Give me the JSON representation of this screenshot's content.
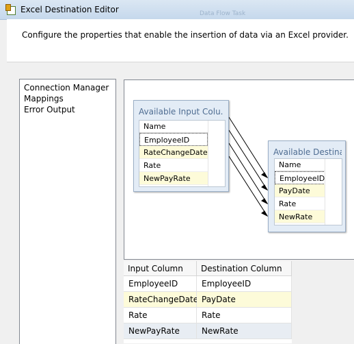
{
  "window": {
    "title": "Excel Destination Editor",
    "ghost_text": "Data Flow Task"
  },
  "header": {
    "description": "Configure the properties that enable the insertion of data via an Excel provider."
  },
  "nav": {
    "items": [
      "Connection Manager",
      "Mappings",
      "Error Output"
    ]
  },
  "mapping": {
    "input_box": {
      "title": "Available Input Colu...",
      "header": "Name",
      "columns": [
        "EmployeeID",
        "RateChangeDate",
        "Rate",
        "NewPayRate"
      ]
    },
    "dest_box": {
      "title": "Available Destina...",
      "header": "Name",
      "columns": [
        "EmployeeID",
        "PayDate",
        "Rate",
        "NewRate"
      ]
    }
  },
  "grid": {
    "headers": [
      "Input Column",
      "Destination Column"
    ],
    "rows": [
      [
        "EmployeeID",
        "EmployeeID"
      ],
      [
        "RateChangeDate",
        "PayDate"
      ],
      [
        "Rate",
        "Rate"
      ],
      [
        "NewPayRate",
        "NewRate"
      ]
    ]
  }
}
